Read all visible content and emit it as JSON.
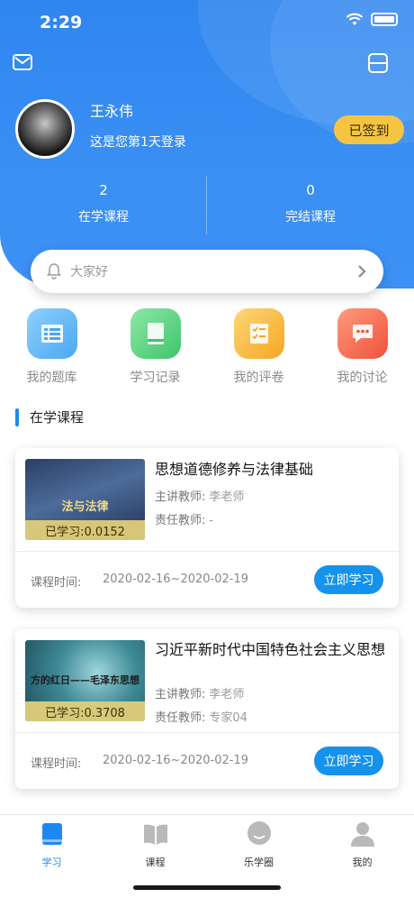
{
  "status_bar": {
    "time": "2:29"
  },
  "profile": {
    "name": "王永伟",
    "login_info": "这是您第1天登录",
    "signed_label": "已签到"
  },
  "stats": [
    {
      "value": "2",
      "label": "在学课程"
    },
    {
      "value": "0",
      "label": "完结课程"
    }
  ],
  "notice": {
    "text": "大家好"
  },
  "quick_actions": [
    {
      "label": "我的题库",
      "icon": "question-bank-icon",
      "color": "#5fb3f5"
    },
    {
      "label": "学习记录",
      "icon": "study-record-icon",
      "color": "#4fcf7c"
    },
    {
      "label": "我的评卷",
      "icon": "exam-review-icon",
      "color": "#f7b936"
    },
    {
      "label": "我的讨论",
      "icon": "discussion-icon",
      "color": "#f56a4d"
    }
  ],
  "section": {
    "title": "在学课程"
  },
  "courses": [
    {
      "thumb_text": "法与法律",
      "progress": "已学习:0.0152",
      "title": "思想道德修养与法律基础",
      "lead_teacher_label": "主讲教师:",
      "lead_teacher": "李老师",
      "resp_teacher_label": "责任教师:",
      "resp_teacher": "-",
      "time_label": "课程时间:",
      "time": "2020-02-16~2020-02-19",
      "button": "立即学习"
    },
    {
      "thumb_text": "方的红日——毛泽东思想",
      "progress": "已学习:0.3708",
      "title": "习近平新时代中国特色社会主义思想",
      "lead_teacher_label": "主讲教师:",
      "lead_teacher": "李老师",
      "resp_teacher_label": "责任教师:",
      "resp_teacher": "专家04",
      "time_label": "课程时间:",
      "time": "2020-02-16~2020-02-19",
      "button": "立即学习"
    }
  ],
  "tabbar": [
    {
      "label": "学习",
      "icon": "study-book-icon",
      "active": true
    },
    {
      "label": "课程",
      "icon": "open-book-icon",
      "active": false
    },
    {
      "label": "乐学圈",
      "icon": "chat-circle-icon",
      "active": false
    },
    {
      "label": "我的",
      "icon": "person-icon",
      "active": false
    }
  ],
  "colors": {
    "primary": "#1e88f0",
    "hero": "#3a8ff3",
    "signed": "#f5c542",
    "button": "#1592ec"
  }
}
